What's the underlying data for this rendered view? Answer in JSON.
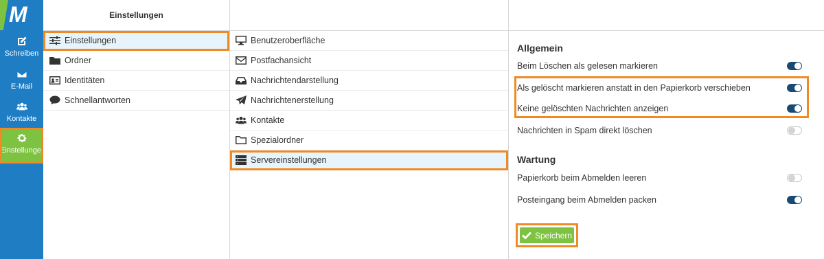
{
  "taskbar": {
    "logo": "M",
    "items": [
      {
        "label": "Schreiben",
        "icon": "compose-icon"
      },
      {
        "label": "E-Mail",
        "icon": "envelope-icon"
      },
      {
        "label": "Kontakte",
        "icon": "users-icon"
      },
      {
        "label": "Einstellungen",
        "icon": "gear-icon"
      }
    ]
  },
  "col1": {
    "header": "Einstellungen",
    "items": [
      {
        "label": "Einstellungen",
        "icon": "sliders-icon"
      },
      {
        "label": "Ordner",
        "icon": "folder-icon"
      },
      {
        "label": "Identitäten",
        "icon": "id-card-icon"
      },
      {
        "label": "Schnellantworten",
        "icon": "comment-icon"
      }
    ]
  },
  "col2": {
    "header": "",
    "items": [
      {
        "label": "Benutzeroberfläche",
        "icon": "monitor-icon"
      },
      {
        "label": "Postfachansicht",
        "icon": "envelope-outline-icon"
      },
      {
        "label": "Nachrichtendarstellung",
        "icon": "inbox-icon"
      },
      {
        "label": "Nachrichtenerstellung",
        "icon": "paper-plane-icon"
      },
      {
        "label": "Kontakte",
        "icon": "users-icon"
      },
      {
        "label": "Spezialordner",
        "icon": "folder-outline-icon"
      },
      {
        "label": "Servereinstellungen",
        "icon": "server-icon"
      }
    ]
  },
  "settings": {
    "section1": "Allgemein",
    "rows1": [
      {
        "label": "Beim Löschen als gelesen markieren",
        "on": true
      },
      {
        "label": "Als gelöscht markieren anstatt in den Papierkorb verschieben",
        "on": true
      },
      {
        "label": "Keine gelöschten Nachrichten anzeigen",
        "on": true
      },
      {
        "label": "Nachrichten in Spam direkt löschen",
        "on": false
      }
    ],
    "section2": "Wartung",
    "rows2": [
      {
        "label": "Papierkorb beim Abmelden leeren",
        "on": false
      },
      {
        "label": "Posteingang beim Abmelden packen",
        "on": true
      }
    ],
    "save_label": "Speichern"
  },
  "colors": {
    "taskbar": "#1e7dc3",
    "accent_green": "#7ec242",
    "highlight": "#f08a24",
    "toggle_on": "#1a4a73"
  }
}
